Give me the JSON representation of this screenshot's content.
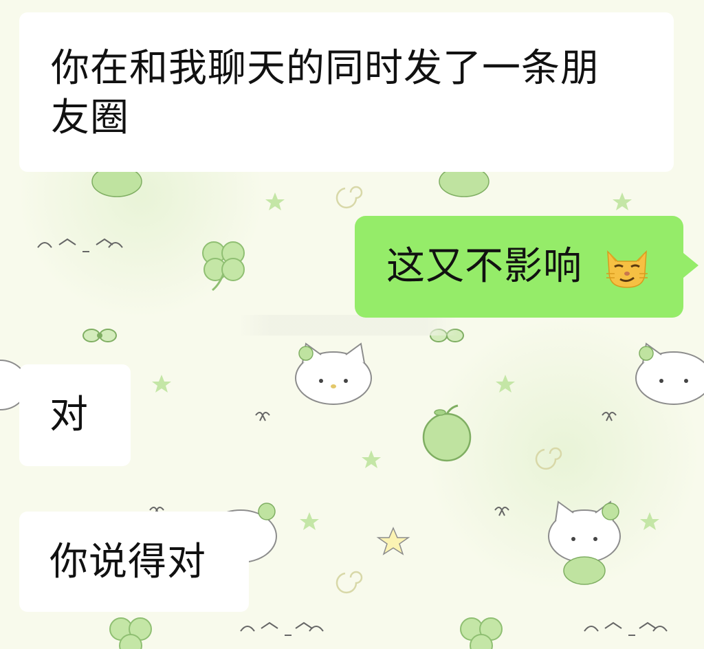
{
  "chat": {
    "messages": [
      {
        "sender": "other",
        "text_line1": "你在和我聊天的同时发了一条朋",
        "text_line2": "友圈"
      },
      {
        "sender": "self",
        "text": "这又不影响",
        "emoji": "smirking-cat-emoji"
      },
      {
        "sender": "other",
        "text": "对"
      },
      {
        "sender": "other",
        "text": "你说得对"
      }
    ]
  },
  "theme": {
    "outgoing_bubble": "#95ec69",
    "incoming_bubble": "#ffffff",
    "wallpaper": "#f8faec",
    "motif_green": "#b9df9c"
  }
}
